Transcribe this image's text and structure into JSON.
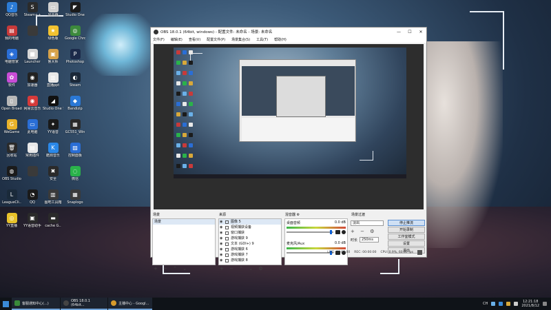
{
  "desktop": {
    "icons": [
      {
        "label": "QQ音乐",
        "color": "#2b7bd6",
        "glyph": "♪"
      },
      {
        "label": "Steam++",
        "color": "#2b2b2b",
        "glyph": "S"
      },
      {
        "label": "显示器",
        "color": "#d0d0d0",
        "glyph": "▭"
      },
      {
        "label": "Studio One",
        "color": "#1b1b1b",
        "glyph": "◤"
      },
      {
        "label": "我的电脑",
        "color": "#c83a3a",
        "glyph": "▤"
      },
      {
        "label": "",
        "color": "#3a3a3a",
        "glyph": ""
      },
      {
        "label": "绿色版",
        "color": "#f2c230",
        "glyph": "★"
      },
      {
        "label": "Google Chrome",
        "color": "#3c8a3c",
        "glyph": "◎"
      },
      {
        "label": "电脑管家",
        "color": "#2a6ed6",
        "glyph": "◈"
      },
      {
        "label": "Launcher",
        "color": "#d6d6d6",
        "glyph": "■"
      },
      {
        "label": "鲁大师",
        "color": "#d6a24a",
        "glyph": "▣"
      },
      {
        "label": "Photoshop",
        "color": "#1c2a4a",
        "glyph": "P"
      },
      {
        "label": "软件",
        "color": "#c84dd6",
        "glyph": "✿"
      },
      {
        "label": "加速器",
        "color": "#222",
        "glyph": "◉"
      },
      {
        "label": "直播ppt",
        "color": "#e8e8e8",
        "glyph": "▥"
      },
      {
        "label": "Steam",
        "color": "#1b2838",
        "glyph": "◐"
      },
      {
        "label": "Open Broadcast",
        "color": "#b8b8b8",
        "glyph": "▯"
      },
      {
        "label": "网易云音乐",
        "color": "#d63a3a",
        "glyph": "◉"
      },
      {
        "label": "Studio One 5",
        "color": "#111",
        "glyph": "◢"
      },
      {
        "label": "Bandizip",
        "color": "#2a78d6",
        "glyph": "◆"
      },
      {
        "label": "WeGame",
        "color": "#e8b22a",
        "glyph": "G"
      },
      {
        "label": "此电脑",
        "color": "#2a6ed6",
        "glyph": "▭"
      },
      {
        "label": "YY语音",
        "color": "#1a1a1a",
        "glyph": "✦"
      },
      {
        "label": "GC551_Win",
        "color": "#2a2a2a",
        "glyph": "▦"
      },
      {
        "label": "回收站",
        "color": "#2a2a2a",
        "glyph": "🗑"
      },
      {
        "label": "常用插件",
        "color": "#e8e8e8",
        "glyph": "▤"
      },
      {
        "label": "酷狗音乐",
        "color": "#2a88e8",
        "glyph": "K"
      },
      {
        "label": "控制面板",
        "color": "#2a6ed6",
        "glyph": "▨"
      },
      {
        "label": "OBS Studio",
        "color": "#1b1b1b",
        "glyph": "◍"
      },
      {
        "label": "",
        "color": "#3a3a3a",
        "glyph": ""
      },
      {
        "label": "安全",
        "color": "#2a2a2a",
        "glyph": "✖"
      },
      {
        "label": "微信",
        "color": "#2ab24a",
        "glyph": "◌"
      },
      {
        "label": "LeagueCli..",
        "color": "#1a2a3a",
        "glyph": "L"
      },
      {
        "label": "QQ",
        "color": "#1a1a1a",
        "glyph": "◔"
      },
      {
        "label": "图吧工具箱",
        "color": "#3a3a3a",
        "glyph": "▥"
      },
      {
        "label": "Snaplogo",
        "color": "#3a3a3a",
        "glyph": "▦"
      },
      {
        "label": "YY直播",
        "color": "#e8c22a",
        "glyph": "◎"
      },
      {
        "label": "YY语音助手",
        "color": "#2a2a2a",
        "glyph": "▣"
      },
      {
        "label": "cache G..",
        "color": "#2a2a2a",
        "glyph": "▬"
      }
    ]
  },
  "obs": {
    "title": "OBS 18.0.1 (64bit, windows) - 配置文件: 未命名 - 场景: 未命名",
    "window_controls": [
      "—",
      "☐",
      "✕"
    ],
    "menu": [
      "文件(F)",
      "编辑(E)",
      "查看(V)",
      "配置文件(P)",
      "场景集合(S)",
      "工具(T)",
      "帮助(H)"
    ],
    "docks": {
      "scenes": {
        "title": "场景",
        "items": [
          "场景"
        ]
      },
      "sources": {
        "title": "来源",
        "items": [
          "图像 5",
          "视频捕获设备",
          "窗口捕获",
          "游戏捕获 9",
          "文本 (GDI+) 9",
          "游戏捕获 6",
          "游戏捕获 7",
          "游戏捕获 8"
        ]
      },
      "mixer": {
        "title": "混音器",
        "channels": [
          {
            "name": "桌面音频",
            "level": "0.0 dB"
          },
          {
            "name": "麦克风/Aux",
            "level": "0.0 dB"
          }
        ]
      },
      "transitions": {
        "title": "场景过渡",
        "selected": "淡出",
        "duration_label": "时长",
        "duration": "250ms"
      },
      "controls": [
        "停止推流",
        "开始录制",
        "工作室模式",
        "设置",
        "退出"
      ]
    },
    "status": {
      "live": "LIVE: 00:00:00",
      "rec": "REC: 00:00:00",
      "cpu": "CPU: 0.9%, 60.00 fps"
    },
    "tools_glyphs": "+ − ⌃ ⌄"
  },
  "taskbar": {
    "items": [
      {
        "label": "客服通知中心(...)",
        "color": "#3a8a3a"
      },
      {
        "label": "OBS 18.0.1 (64bit...",
        "color": "#2a2a2a"
      },
      {
        "label": "主播中心 - Googl...",
        "color": "#d89a2a"
      }
    ],
    "ime": "CH",
    "time": "12:21:18",
    "date": "2021/8/12"
  }
}
